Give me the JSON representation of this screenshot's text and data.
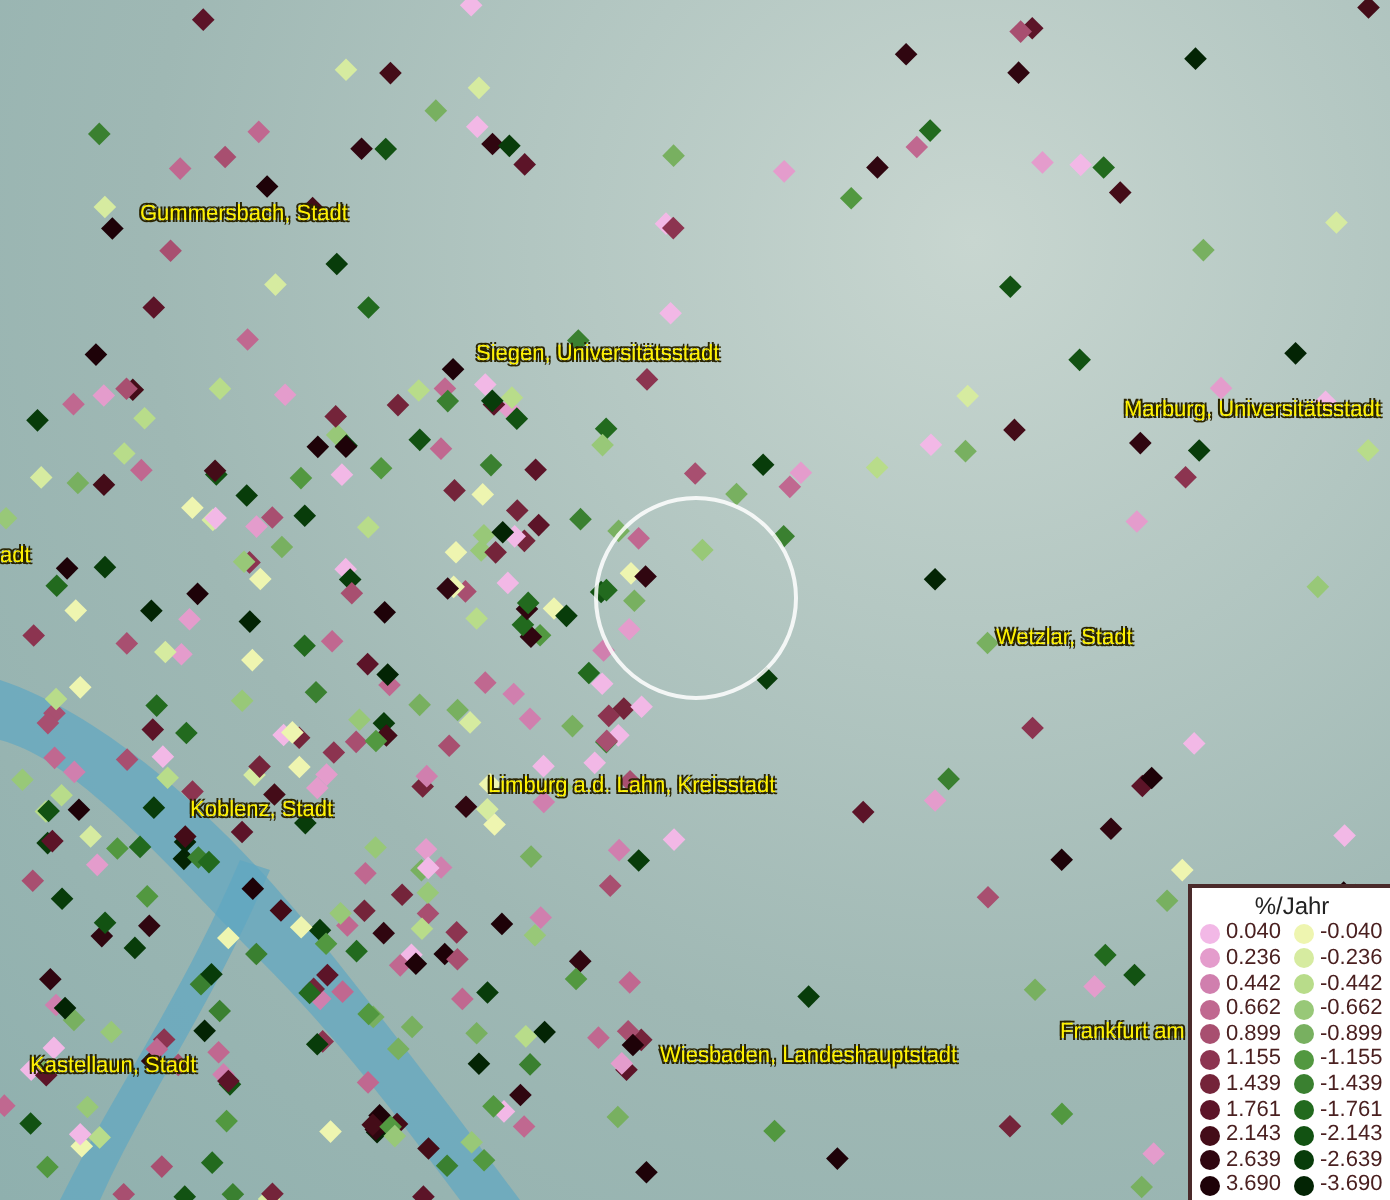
{
  "places": [
    {
      "name": "Gummersbach, Stadt"
    },
    {
      "name": "Siegen, Universitätsstadt"
    },
    {
      "name": "Marburg, Universitätsstadt"
    },
    {
      "name": "adt"
    },
    {
      "name": "Wetzlar, Stadt"
    },
    {
      "name": "Limburg a.d. Lahn, Kreisstadt"
    },
    {
      "name": "Koblenz, Stadt"
    },
    {
      "name": "Kastellaun, Stadt"
    },
    {
      "name": "Wiesbaden, Landeshauptstadt"
    },
    {
      "name": "Frankfurt am"
    }
  ],
  "legend": {
    "title": "%/Jahr",
    "rows": [
      {
        "positive": {
          "value": "0.040",
          "color": "#f2b8e6"
        },
        "negative": {
          "value": "-0.040",
          "color": "#eef5b0"
        }
      },
      {
        "positive": {
          "value": "0.236",
          "color": "#e49ccc"
        },
        "negative": {
          "value": "-0.236",
          "color": "#d6eba0"
        }
      },
      {
        "positive": {
          "value": "0.442",
          "color": "#d07fae"
        },
        "negative": {
          "value": "-0.442",
          "color": "#b8dc8a"
        }
      },
      {
        "positive": {
          "value": "0.662",
          "color": "#c06890"
        },
        "negative": {
          "value": "-0.662",
          "color": "#98c878"
        }
      },
      {
        "positive": {
          "value": "0.899",
          "color": "#a84f70"
        },
        "negative": {
          "value": "-0.899",
          "color": "#78b060"
        }
      },
      {
        "positive": {
          "value": "1.155",
          "color": "#8c3450"
        },
        "negative": {
          "value": "-1.155",
          "color": "#529840"
        }
      },
      {
        "positive": {
          "value": "1.439",
          "color": "#74243a"
        },
        "negative": {
          "value": "-1.439",
          "color": "#3a8030"
        }
      },
      {
        "positive": {
          "value": "1.761",
          "color": "#5c1428"
        },
        "negative": {
          "value": "-1.761",
          "color": "#226a1e"
        }
      },
      {
        "positive": {
          "value": "2.143",
          "color": "#440c18"
        },
        "negative": {
          "value": "-2.143",
          "color": "#125212"
        }
      },
      {
        "positive": {
          "value": "2.639",
          "color": "#300610"
        },
        "negative": {
          "value": "-2.639",
          "color": "#083c0a"
        }
      },
      {
        "positive": {
          "value": "3.690",
          "color": "#1e0208"
        },
        "negative": {
          "value": "-3.690",
          "color": "#032404"
        }
      }
    ]
  }
}
